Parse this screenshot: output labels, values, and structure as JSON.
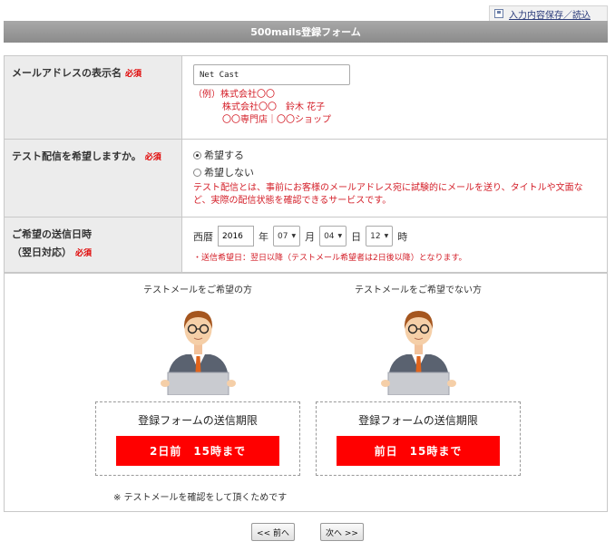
{
  "top": {
    "save_link": "入力内容保存／読込"
  },
  "header": {
    "title": "500mails登録フォーム"
  },
  "form": {
    "display_name": {
      "label": "メールアドレスの表示名",
      "required": "必須",
      "value": "Net Cast",
      "example_prefix": "（例）",
      "examples": [
        "株式会社〇〇",
        "株式会社〇〇　鈴木 花子",
        "〇〇専門店｜〇〇ショップ"
      ]
    },
    "test_delivery": {
      "label": "テスト配信を希望しますか。",
      "required": "必須",
      "option_yes": "希望する",
      "option_no": "希望しない",
      "selected": "希望する",
      "desc_line1": "テスト配信とは、事前にお客様のメールアドレス宛に試験的にメールを送り、タイトルや文面な",
      "desc_line2": "ど、実際の配信状態を確認できるサービスです。"
    },
    "send_date": {
      "label_line1": "ご希望の送信日時",
      "label_line2": "（翌日対応）",
      "required": "必須",
      "era_label": "西暦",
      "year": "2016",
      "year_unit": "年",
      "month": "07",
      "month_unit": "月",
      "day": "04",
      "day_unit": "日",
      "hour": "12",
      "hour_unit": "時",
      "note": "・送信希望日：翌日以降（テストメール希望者は2日後以降）となります。"
    }
  },
  "info": {
    "with_test": {
      "title": "テストメールをご希望の方",
      "box_title": "登録フォームの送信期限",
      "deadline": "2日前　15時まで"
    },
    "without_test": {
      "title": "テストメールをご希望でない方",
      "box_title": "登録フォームの送信期限",
      "deadline": "前日　15時まで"
    },
    "footnote": "※ テストメールを確認をして頂くためです"
  },
  "nav": {
    "prev": "<< 前へ",
    "next": "次へ >>"
  },
  "colors": {
    "accent_red": "#ff0000",
    "text_red": "#d4202a",
    "header_gray": "#999999"
  }
}
